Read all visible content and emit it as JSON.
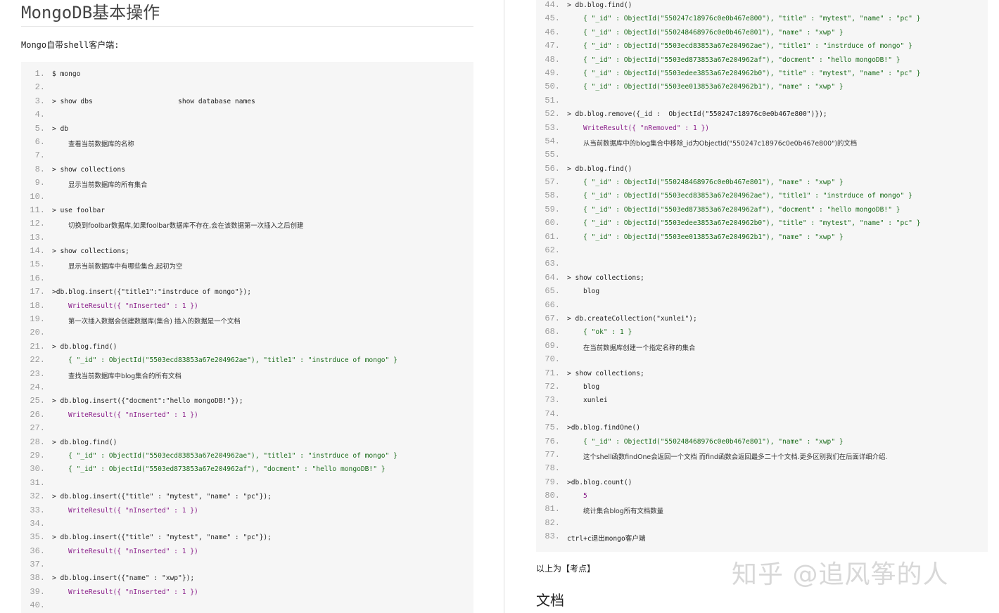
{
  "left": {
    "title": "MongoDB基本操作",
    "intro": "Mongo自带shell客户端:",
    "lines": [
      {
        "n": "1.",
        "t": "$ mongo",
        "k": "cmd"
      },
      {
        "n": "2.",
        "t": "",
        "k": "cmd"
      },
      {
        "n": "3.",
        "t": "> show dbs                     show database names",
        "k": "cmd"
      },
      {
        "n": "4.",
        "t": "",
        "k": "cmd"
      },
      {
        "n": "5.",
        "t": "> db",
        "k": "cmd"
      },
      {
        "n": "6.",
        "t": "查看当前数据库的名称",
        "k": "zh"
      },
      {
        "n": "7.",
        "t": "",
        "k": "cmd"
      },
      {
        "n": "8.",
        "t": "> show collections",
        "k": "cmd"
      },
      {
        "n": "9.",
        "t": "显示当前数据库的所有集合",
        "k": "zh"
      },
      {
        "n": "10.",
        "t": "",
        "k": "cmd"
      },
      {
        "n": "11.",
        "t": "> use foolbar",
        "k": "cmd"
      },
      {
        "n": "12.",
        "t": "切换到foolbar数据库,如果foolbar数据库不存在,会在该数据第一次插入之后创建",
        "k": "zh"
      },
      {
        "n": "13.",
        "t": "",
        "k": "cmd"
      },
      {
        "n": "14.",
        "t": "> show collections;",
        "k": "cmd"
      },
      {
        "n": "15.",
        "t": "显示当前数据库中有哪些集合,起初为空",
        "k": "zh"
      },
      {
        "n": "16.",
        "t": "",
        "k": "cmd"
      },
      {
        "n": "17.",
        "t": ">db.blog.insert({\"title1\":\"instrduce of mongo\"});",
        "k": "cmd"
      },
      {
        "n": "18.",
        "t": "WriteResult({ \"nInserted\" : 1 })",
        "k": "res"
      },
      {
        "n": "19.",
        "t": "第一次插入数据会创建数据库(集合) 插入的数据是一个文档",
        "k": "zh"
      },
      {
        "n": "20.",
        "t": "",
        "k": "cmd"
      },
      {
        "n": "21.",
        "t": "> db.blog.find()",
        "k": "cmd"
      },
      {
        "n": "22.",
        "t": "{ \"_id\" : ObjectId(\"5503ecd83853a67e204962ae\"), \"title1\" : \"instrduce of mongo\" }",
        "k": "doc"
      },
      {
        "n": "23.",
        "t": "查找当前数据库中blog集合的所有文档",
        "k": "zh"
      },
      {
        "n": "24.",
        "t": "",
        "k": "cmd"
      },
      {
        "n": "25.",
        "t": "> db.blog.insert({\"docment\":\"hello mongoDB!\"});",
        "k": "cmd"
      },
      {
        "n": "26.",
        "t": "WriteResult({ \"nInserted\" : 1 })",
        "k": "res"
      },
      {
        "n": "27.",
        "t": "",
        "k": "cmd"
      },
      {
        "n": "28.",
        "t": "> db.blog.find()",
        "k": "cmd"
      },
      {
        "n": "29.",
        "t": "{ \"_id\" : ObjectId(\"5503ecd83853a67e204962ae\"), \"title1\" : \"instrduce of mongo\" }",
        "k": "doc"
      },
      {
        "n": "30.",
        "t": "{ \"_id\" : ObjectId(\"5503ed873853a67e204962af\"), \"docment\" : \"hello mongoDB!\" }",
        "k": "doc"
      },
      {
        "n": "31.",
        "t": "",
        "k": "cmd"
      },
      {
        "n": "32.",
        "t": "> db.blog.insert({\"title\" : \"mytest\", \"name\" : \"pc\"});",
        "k": "cmd"
      },
      {
        "n": "33.",
        "t": "WriteResult({ \"nInserted\" : 1 })",
        "k": "res"
      },
      {
        "n": "34.",
        "t": "",
        "k": "cmd"
      },
      {
        "n": "35.",
        "t": "> db.blog.insert({\"title\" : \"mytest\", \"name\" : \"pc\"});",
        "k": "cmd"
      },
      {
        "n": "36.",
        "t": "WriteResult({ \"nInserted\" : 1 })",
        "k": "res"
      },
      {
        "n": "37.",
        "t": "",
        "k": "cmd"
      },
      {
        "n": "38.",
        "t": "> db.blog.insert({\"name\" : \"xwp\"});",
        "k": "cmd"
      },
      {
        "n": "39.",
        "t": "WriteResult({ \"nInserted\" : 1 })",
        "k": "res"
      },
      {
        "n": "40.",
        "t": "",
        "k": "cmd"
      }
    ]
  },
  "right": {
    "lines": [
      {
        "n": "44.",
        "t": "> db.blog.find()",
        "k": "cmd"
      },
      {
        "n": "45.",
        "t": "{ \"_id\" : ObjectId(\"550247c18976c0e0b467e800\"), \"title\" : \"mytest\", \"name\" : \"pc\" }",
        "k": "doc"
      },
      {
        "n": "46.",
        "t": "{ \"_id\" : ObjectId(\"550248468976c0e0b467e801\"), \"name\" : \"xwp\" }",
        "k": "doc"
      },
      {
        "n": "47.",
        "t": "{ \"_id\" : ObjectId(\"5503ecd83853a67e204962ae\"), \"title1\" : \"instrduce of mongo\" }",
        "k": "doc"
      },
      {
        "n": "48.",
        "t": "{ \"_id\" : ObjectId(\"5503ed873853a67e204962af\"), \"docment\" : \"hello mongoDB!\" }",
        "k": "doc"
      },
      {
        "n": "49.",
        "t": "{ \"_id\" : ObjectId(\"5503edee3853a67e204962b0\"), \"title\" : \"mytest\", \"name\" : \"pc\" }",
        "k": "doc"
      },
      {
        "n": "50.",
        "t": "{ \"_id\" : ObjectId(\"5503ee013853a67e204962b1\"), \"name\" : \"xwp\" }",
        "k": "doc"
      },
      {
        "n": "51.",
        "t": "",
        "k": "cmd"
      },
      {
        "n": "52.",
        "t": "> db.blog.remove({_id :  ObjectId(\"550247c18976c0e0b467e800\")});",
        "k": "cmd"
      },
      {
        "n": "53.",
        "t": "WriteResult({ \"nRemoved\" : 1 })",
        "k": "res"
      },
      {
        "n": "54.",
        "t": "从当前数据库中的blog集合中移除_id为ObjectId(\"550247c18976c0e0b467e800\")的文档",
        "k": "zh"
      },
      {
        "n": "55.",
        "t": "",
        "k": "cmd"
      },
      {
        "n": "56.",
        "t": "> db.blog.find()",
        "k": "cmd"
      },
      {
        "n": "57.",
        "t": "{ \"_id\" : ObjectId(\"550248468976c0e0b467e801\"), \"name\" : \"xwp\" }",
        "k": "doc"
      },
      {
        "n": "58.",
        "t": "{ \"_id\" : ObjectId(\"5503ecd83853a67e204962ae\"), \"title1\" : \"instrduce of mongo\" }",
        "k": "doc"
      },
      {
        "n": "59.",
        "t": "{ \"_id\" : ObjectId(\"5503ed873853a67e204962af\"), \"docment\" : \"hello mongoDB!\" }",
        "k": "doc"
      },
      {
        "n": "60.",
        "t": "{ \"_id\" : ObjectId(\"5503edee3853a67e204962b0\"), \"title\" : \"mytest\", \"name\" : \"pc\" }",
        "k": "doc"
      },
      {
        "n": "61.",
        "t": "{ \"_id\" : ObjectId(\"5503ee013853a67e204962b1\"), \"name\" : \"xwp\" }",
        "k": "doc"
      },
      {
        "n": "62.",
        "t": "",
        "k": "cmd"
      },
      {
        "n": "63.",
        "t": "",
        "k": "cmd"
      },
      {
        "n": "64.",
        "t": "> show collections;",
        "k": "cmd"
      },
      {
        "n": "65.",
        "t": "blog",
        "k": "out"
      },
      {
        "n": "66.",
        "t": "",
        "k": "cmd"
      },
      {
        "n": "67.",
        "t": "> db.createCollection(\"xunlei\");",
        "k": "cmd"
      },
      {
        "n": "68.",
        "t": "{ \"ok\" : 1 }",
        "k": "doc"
      },
      {
        "n": "69.",
        "t": "在当前数据库创建一个指定名称的集合",
        "k": "zh"
      },
      {
        "n": "70.",
        "t": "",
        "k": "cmd"
      },
      {
        "n": "71.",
        "t": "> show collections;",
        "k": "cmd"
      },
      {
        "n": "72.",
        "t": "blog",
        "k": "out"
      },
      {
        "n": "73.",
        "t": "xunlei",
        "k": "out"
      },
      {
        "n": "74.",
        "t": "",
        "k": "cmd"
      },
      {
        "n": "75.",
        "t": ">db.blog.findOne()",
        "k": "cmd"
      },
      {
        "n": "76.",
        "t": "{ \"_id\" : ObjectId(\"550248468976c0e0b467e801\"), \"name\" : \"xwp\" }",
        "k": "doc"
      },
      {
        "n": "77.",
        "t": "这个shell函数findOne会返回一个文档 而find函数会返回最多二十个文档.更多区别我们在后面详细介绍.",
        "k": "zh"
      },
      {
        "n": "78.",
        "t": "",
        "k": "cmd"
      },
      {
        "n": "79.",
        "t": ">db.blog.count()",
        "k": "cmd"
      },
      {
        "n": "80.",
        "t": "5",
        "k": "res"
      },
      {
        "n": "81.",
        "t": "统计集合blog所有文档数量",
        "k": "zh"
      },
      {
        "n": "82.",
        "t": "",
        "k": "cmd"
      },
      {
        "n": "83.",
        "t": "ctrl+c退出mongo客户端",
        "k": "cmd"
      }
    ],
    "after_text": "以上为【考点】",
    "next_heading": "文档"
  },
  "watermark": "知乎 @追风筝的人",
  "colors": {
    "code_bg": "#f6f6f6",
    "line_number": "#9a9a9a",
    "result": "#8a1f8a",
    "document": "#1a6b1a"
  }
}
